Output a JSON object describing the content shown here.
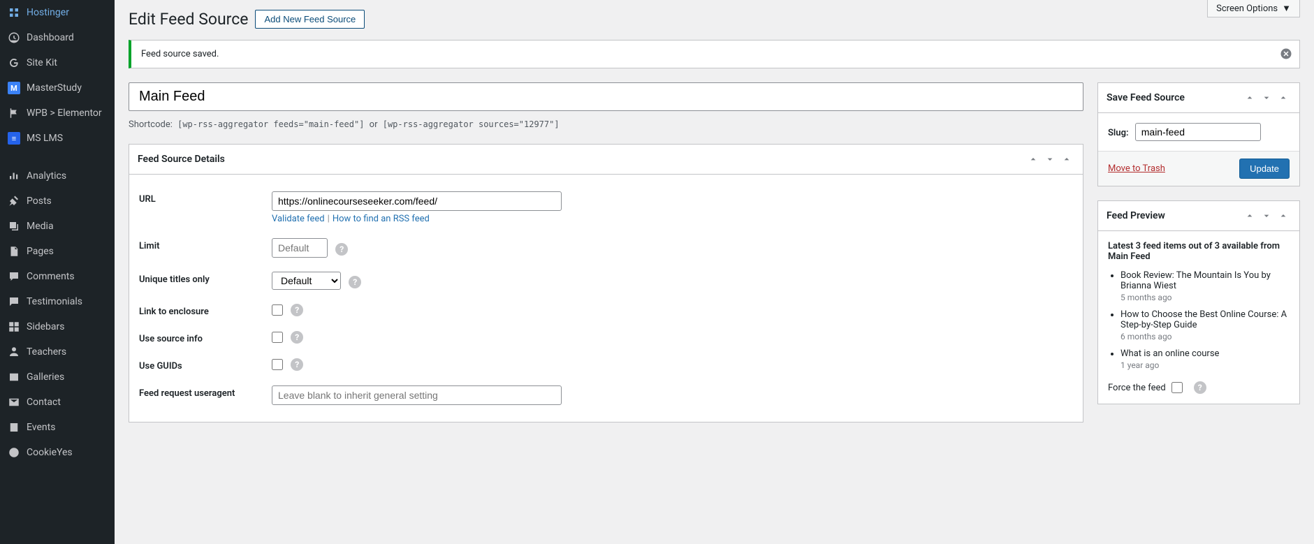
{
  "screen_options": "Screen Options",
  "sidebar": {
    "items": [
      {
        "label": "Hostinger"
      },
      {
        "label": "Dashboard"
      },
      {
        "label": "Site Kit"
      },
      {
        "label": "MasterStudy"
      },
      {
        "label": "WPB > Elementor"
      },
      {
        "label": "MS LMS"
      },
      {
        "label": "Analytics"
      },
      {
        "label": "Posts"
      },
      {
        "label": "Media"
      },
      {
        "label": "Pages"
      },
      {
        "label": "Comments"
      },
      {
        "label": "Testimonials"
      },
      {
        "label": "Sidebars"
      },
      {
        "label": "Teachers"
      },
      {
        "label": "Galleries"
      },
      {
        "label": "Contact"
      },
      {
        "label": "Events"
      },
      {
        "label": "CookieYes"
      }
    ]
  },
  "header": {
    "title": "Edit Feed Source",
    "add_button": "Add New Feed Source"
  },
  "notice": {
    "message": "Feed source saved."
  },
  "title_input": "Main Feed",
  "shortcode": {
    "label": "Shortcode:",
    "code1": "[wp-rss-aggregator feeds=\"main-feed\"]",
    "or": "or",
    "code2": "[wp-rss-aggregator sources=\"12977\"]"
  },
  "details_box": {
    "title": "Feed Source Details",
    "url_label": "URL",
    "url_value": "https://onlinecourseseeker.com/feed/",
    "validate_link": "Validate feed",
    "howto_link": "How to find an RSS feed",
    "limit_label": "Limit",
    "limit_placeholder": "Default",
    "unique_label": "Unique titles only",
    "unique_value": "Default",
    "enclosure_label": "Link to enclosure",
    "source_info_label": "Use source info",
    "guids_label": "Use GUIDs",
    "useragent_label": "Feed request useragent",
    "useragent_placeholder": "Leave blank to inherit general setting"
  },
  "save_box": {
    "title": "Save Feed Source",
    "slug_label": "Slug:",
    "slug_value": "main-feed",
    "trash_link": "Move to Trash",
    "update_button": "Update"
  },
  "preview_box": {
    "title": "Feed Preview",
    "meta": "Latest 3 feed items out of 3 available from Main Feed",
    "items": [
      {
        "title": "Book Review: The Mountain Is You by Brianna Wiest",
        "time": "5 months ago"
      },
      {
        "title": "How to Choose the Best Online Course: A Step-by-Step Guide",
        "time": "6 months ago"
      },
      {
        "title": "What is an online course",
        "time": "1 year ago"
      }
    ],
    "force_label": "Force the feed"
  }
}
